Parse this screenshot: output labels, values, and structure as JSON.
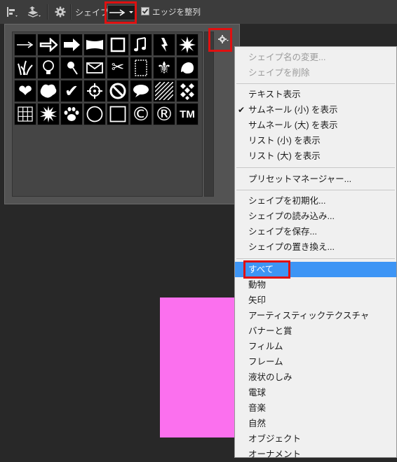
{
  "toolbar": {
    "shape_label": "シェイプ：",
    "align_edges_label": "エッジを整列",
    "align_edges_checked": true,
    "selected_shape_icon": "arrow-right-icon"
  },
  "colors": {
    "highlight": "#e01010",
    "selected_item": "#3d95f5",
    "canvas_shape": "#fb70ee"
  },
  "shape_grid": [
    [
      "arrow-thin-icon",
      "arrow-bold-icon",
      "arrow-thick-icon",
      "banner-icon",
      "frame-icon",
      "music-notes-icon",
      "lightning-icon",
      "starburst-icon"
    ],
    [
      "grass-icon",
      "lightbulb-icon",
      "pushpin-icon",
      "envelope-icon",
      "scissors-icon",
      "stamp-frame-icon",
      "fleur-de-lis-icon",
      "leaf-ornament-icon"
    ],
    [
      "heart-icon",
      "blob-icon",
      "checkmark-icon",
      "target-icon",
      "no-symbol-icon",
      "speech-bubble-icon",
      "hatch-pattern-icon",
      "diamond-pattern-icon"
    ],
    [
      "grid-icon",
      "burst-icon",
      "paw-print-icon",
      "circle-icon",
      "square-icon",
      "copyright-icon",
      "registered-icon",
      "trademark-icon"
    ]
  ],
  "shape_grid_glyphs": {
    "copyright": "©",
    "registered": "®",
    "trademark": "TM",
    "envelope": "✉",
    "scissors": "✂",
    "fleur": "⚜",
    "check": "✔",
    "no": "⊘",
    "music": "♫",
    "heart": "❤"
  },
  "menu": {
    "disabled_items": [
      "シェイプ名の変更...",
      "シェイプを削除"
    ],
    "view_items": [
      {
        "label": "テキスト表示",
        "checked": false
      },
      {
        "label": "サムネール (小) を表示",
        "checked": true
      },
      {
        "label": "サムネール (大) を表示",
        "checked": false
      },
      {
        "label": "リスト (小) を表示",
        "checked": false
      },
      {
        "label": "リスト (大) を表示",
        "checked": false
      }
    ],
    "preset_manager": "プリセットマネージャー...",
    "file_items": [
      "シェイプを初期化...",
      "シェイプの読み込み...",
      "シェイプを保存...",
      "シェイプの置き換え..."
    ],
    "categories": [
      "すべて",
      "動物",
      "矢印",
      "アーティスティックテクスチャ",
      "バナーと賞",
      "フィルム",
      "フレーム",
      "液状のしみ",
      "電球",
      "音楽",
      "自然",
      "オブジェクト",
      "オーナメント"
    ],
    "selected_category": "すべて"
  }
}
